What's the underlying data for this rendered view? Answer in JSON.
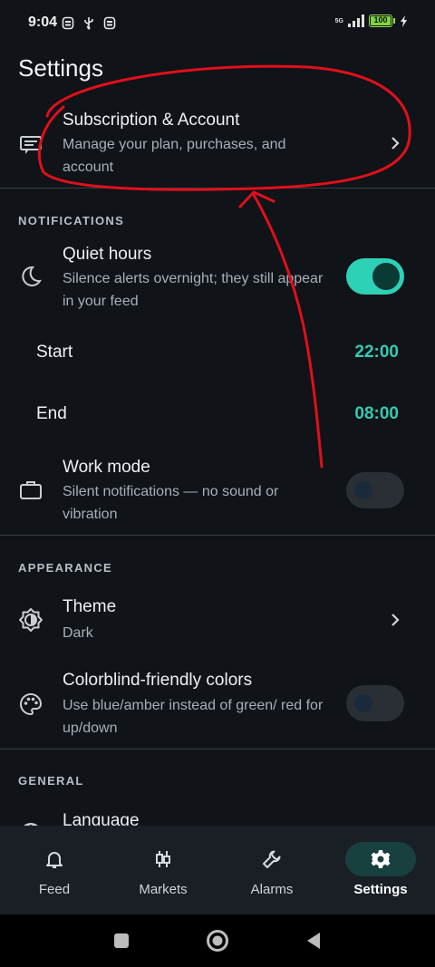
{
  "status_bar": {
    "time": "9:04",
    "network": "5G",
    "battery": "100"
  },
  "header": {
    "title": "Settings"
  },
  "subscription": {
    "title": "Subscription & Account",
    "subtitle": "Manage your plan, purchases, and account"
  },
  "notifications": {
    "section_label": "NOTIFICATIONS",
    "quiet_hours": {
      "title": "Quiet hours",
      "subtitle": "Silence alerts overnight; they still appear in your feed",
      "enabled": true
    },
    "start": {
      "label": "Start",
      "value": "22:00"
    },
    "end": {
      "label": "End",
      "value": "08:00"
    },
    "work_mode": {
      "title": "Work mode",
      "subtitle": "Silent notifications — no sound or vibration",
      "enabled": false
    }
  },
  "appearance": {
    "section_label": "APPEARANCE",
    "theme": {
      "title": "Theme",
      "subtitle": "Dark"
    },
    "colorblind": {
      "title": "Colorblind-friendly colors",
      "subtitle": "Use blue/amber instead of green/ red for up/down",
      "enabled": false
    }
  },
  "general": {
    "section_label": "GENERAL",
    "language": {
      "title": "Language"
    }
  },
  "bottom_nav": {
    "items": [
      {
        "label": "Feed",
        "icon": "bell-icon",
        "active": false
      },
      {
        "label": "Markets",
        "icon": "candlestick-icon",
        "active": false
      },
      {
        "label": "Alarms",
        "icon": "wrench-icon",
        "active": false
      },
      {
        "label": "Settings",
        "icon": "gear-icon",
        "active": true
      }
    ]
  },
  "colors": {
    "background": "#101318",
    "accent": "#2dd2b6",
    "time_value": "#35c9b3",
    "annotation": "#e0101a"
  }
}
